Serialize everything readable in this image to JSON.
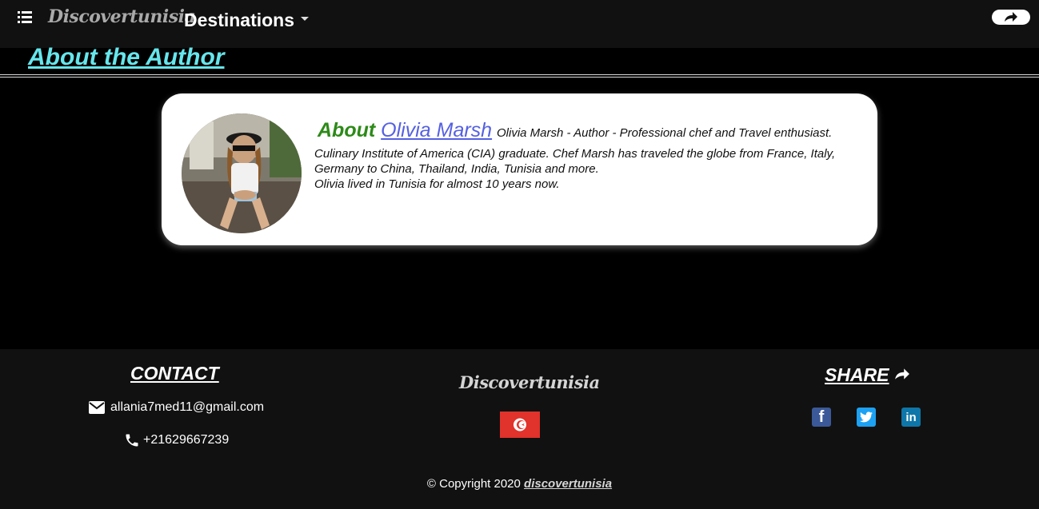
{
  "nav": {
    "brand": "Discovertunisia",
    "destinations_label": "Destinations"
  },
  "page": {
    "heading": "About the Author"
  },
  "author_card": {
    "about_word": "About",
    "author_name": "Olivia Marsh",
    "tagline": "Olivia Marsh - Author - Professional chef and Travel enthusiast.",
    "bio_line1": "Culinary Institute of America (CIA) graduate. Chef Marsh has traveled the globe from France, Italy,",
    "bio_line2": "Germany to China, Thailand, India, Tunisia and more.",
    "bio_line3": "Olivia lived in Tunisia for almost 10 years now."
  },
  "footer": {
    "contact_title": "CONTACT",
    "email": "allania7med11@gmail.com",
    "phone": "+21629667239",
    "brand": "Discovertunisia",
    "share_title": "SHARE",
    "social": [
      {
        "icon": "facebook-icon",
        "label": "f"
      },
      {
        "icon": "twitter-icon",
        "label": ""
      },
      {
        "icon": "linkedin-icon",
        "label": "in"
      }
    ],
    "copyright_prefix": "© Copyright 2020",
    "copyright_site": "discovertunisia"
  },
  "colors": {
    "heading": "#66e6ec",
    "about_word": "#2d8a18",
    "author_link": "#5561e0",
    "flag_red": "#e1322b",
    "footer_bg": "#111111"
  }
}
